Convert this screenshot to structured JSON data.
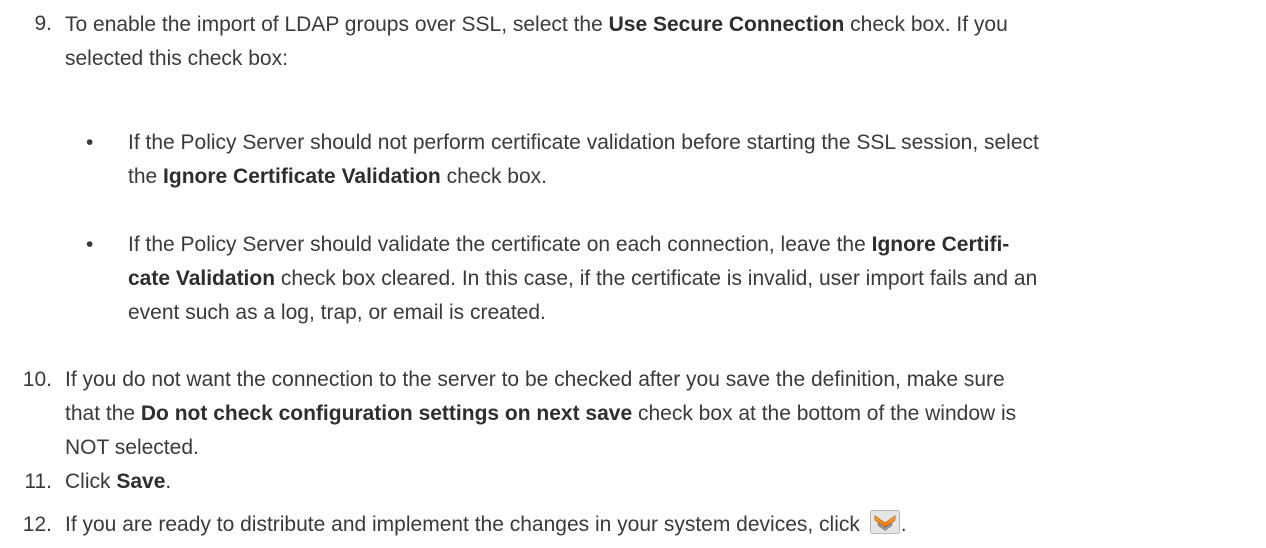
{
  "steps": [
    {
      "number": "9.",
      "lines": [
        [
          "To enable the import of LDAP groups over SSL, select the ",
          "Use Secure Connection",
          " check box. If you"
        ],
        [
          "selected this check box:"
        ]
      ],
      "bullets": [
        {
          "lines": [
            [
              "If the Policy Server should not perform certificate validation before starting the SSL session, select"
            ],
            [
              "the ",
              "Ignore Certificate Validation",
              " check box."
            ]
          ]
        },
        {
          "lines": [
            [
              "If the Policy Server should validate the certificate on each connection, leave the ",
              "Ignore Certifi-"
            ],
            [
              "cate Validation",
              " check box cleared. In this case, if the certificate is invalid, user import fails and an"
            ],
            [
              "event such as a log, trap, or email is created."
            ]
          ]
        }
      ]
    },
    {
      "number": "10.",
      "lines": [
        [
          "If you do not want the connection to the server to be checked after you save the definition, make sure"
        ],
        [
          "that the ",
          "Do not check configuration settings on next save",
          " check box at the bottom of the window is"
        ],
        [
          "NOT selected."
        ]
      ]
    },
    {
      "number": "11.",
      "lines": [
        [
          "Click ",
          "Save",
          "."
        ]
      ]
    },
    {
      "number": "12.",
      "lines": [
        [
          "If you are ready to distribute and implement the changes in your system devices, click ",
          "",
          "."
        ]
      ]
    }
  ],
  "bullet_char": "•",
  "icons": {
    "deploy": "deploy-chevron-icon"
  },
  "colors": {
    "text": "#3a3a3a",
    "icon_orange": "#f08a1c",
    "icon_gray": "#a8a8a8"
  }
}
